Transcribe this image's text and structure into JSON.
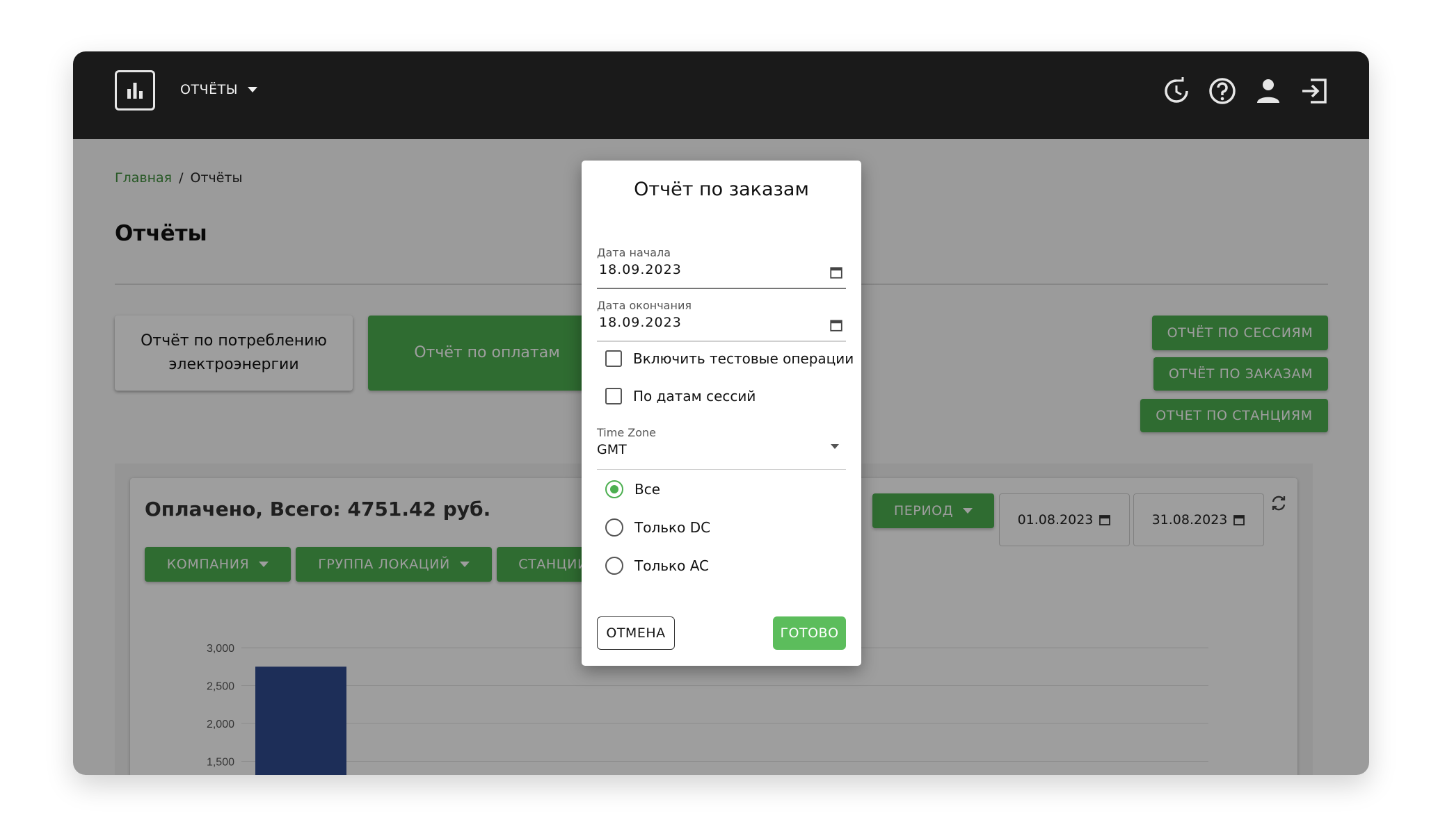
{
  "header": {
    "menu_title": "ОТЧЁТЫ"
  },
  "breadcrumb": {
    "home": "Главная",
    "separator": "/",
    "current": "Отчёты"
  },
  "page": {
    "title": "Отчёты"
  },
  "report_cards": {
    "energy": "Отчёт по потреблению электроэнергии",
    "payments": "Отчёт по оплатам"
  },
  "right_buttons": {
    "sessions": "ОТЧЁТ ПО СЕССИЯМ",
    "orders": "ОТЧЁТ ПО ЗАКАЗАМ",
    "stations": "ОТЧЕТ ПО СТАНЦИЯМ"
  },
  "summary": {
    "paid_total": "Оплачено, Всего: 4751.42 руб."
  },
  "filters": {
    "company": "КОМПАНИЯ",
    "location_group": "ГРУППА ЛОКАЦИЙ",
    "stations": "СТАНЦИИ",
    "period": "ПЕРИОД",
    "date_from": "01.08.2023",
    "date_to": "31.08.2023"
  },
  "chart_data": {
    "type": "bar",
    "y_ticks": [
      "3,000",
      "2,500",
      "2,000",
      "1,500"
    ],
    "ylim": [
      1500,
      3000
    ],
    "values": [
      2750
    ],
    "bar_color": "#2f4b8f"
  },
  "dialog": {
    "title": "Отчёт по заказам",
    "start_label": "Дата начала",
    "start_value": "18.09.2023",
    "end_label": "Дата окончания",
    "end_value": "18.09.2023",
    "include_test": "Включить тестовые операции",
    "by_session_dates": "По датам сессий",
    "timezone_label": "Time Zone",
    "timezone_value": "GMT",
    "radio_all": "Все",
    "radio_dc": "Только DC",
    "radio_ac": "Только AC",
    "cancel": "ОТМЕНА",
    "done": "ГОТОВО"
  },
  "colors": {
    "accent": "#4caf50",
    "topbar": "#1a1a1a"
  }
}
